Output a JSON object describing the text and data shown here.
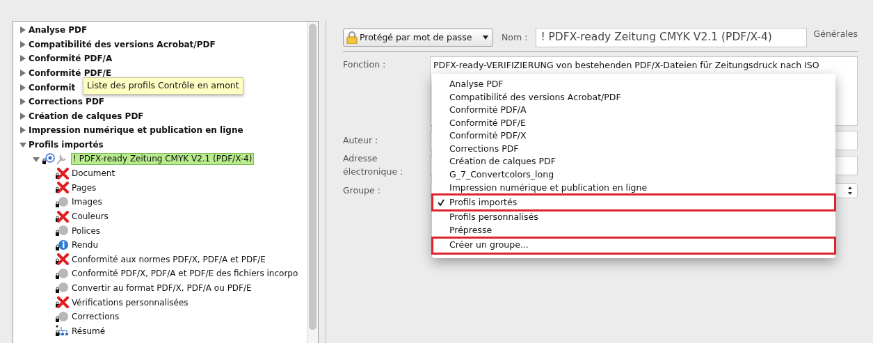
{
  "tree": [
    {
      "label": "Analyse PDF",
      "expanded": false
    },
    {
      "label": "Compatibilité des versions Acrobat/PDF",
      "expanded": false
    },
    {
      "label": "Conformité PDF/A",
      "expanded": false
    },
    {
      "label": "Conformité PDF/E",
      "expanded": false
    },
    {
      "label": "Conformit",
      "expanded": false
    },
    {
      "label": "Corrections PDF",
      "expanded": false
    },
    {
      "label": "Création de calques PDF",
      "expanded": false
    },
    {
      "label": "Impression numérique et publication en ligne",
      "expanded": false
    },
    {
      "label": "Profils importés",
      "expanded": true,
      "children": [
        {
          "label": "! PDFX-ready Zeitung CMYK V2.1 (PDF/X-4)",
          "kind": "profile",
          "expanded": true,
          "selected": true,
          "children": [
            {
              "label": "Document",
              "kind": "error"
            },
            {
              "label": "Pages",
              "kind": "error"
            },
            {
              "label": "Images",
              "kind": "inactive"
            },
            {
              "label": "Couleurs",
              "kind": "error"
            },
            {
              "label": "Polices",
              "kind": "inactive"
            },
            {
              "label": "Rendu",
              "kind": "info"
            },
            {
              "label": "Conformité aux normes PDF/X, PDF/A et PDF/E",
              "kind": "error"
            },
            {
              "label": "Conformité PDF/X, PDF/A et PDF/E des fichiers incorpo",
              "kind": "inactive"
            },
            {
              "label": "Convertir au format PDF/X, PDF/A ou PDF/E",
              "kind": "inactive"
            },
            {
              "label": "Vérifications personnalisées",
              "kind": "error"
            },
            {
              "label": "Corrections",
              "kind": "inactive"
            },
            {
              "label": "Résumé",
              "kind": "summary"
            }
          ]
        }
      ]
    }
  ],
  "tooltip": "Liste des profils Contrôle en amont",
  "protection": {
    "value": "Protégé par mot de passe"
  },
  "name": {
    "label": "Nom :",
    "value": "! PDFX-ready Zeitung CMYK V2.1 (PDF/X-4)"
  },
  "section": "Générales",
  "function": {
    "label": "Fonction :",
    "value": "PDFX-ready-VERIFIZIERUNG von bestehenden PDF/X-Dateien für Zeitungsdruck nach ISO"
  },
  "author": {
    "label": "Auteur :"
  },
  "email": {
    "label": "Adresse électronique :"
  },
  "group": {
    "label": "Groupe :"
  },
  "group_menu": [
    {
      "label": "Analyse PDF",
      "selected": false,
      "highlighted": false
    },
    {
      "label": "Compatibilité des versions Acrobat/PDF",
      "selected": false,
      "highlighted": false
    },
    {
      "label": "Conformité PDF/A",
      "selected": false,
      "highlighted": false
    },
    {
      "label": "Conformité PDF/E",
      "selected": false,
      "highlighted": false
    },
    {
      "label": "Conformité PDF/X",
      "selected": false,
      "highlighted": false
    },
    {
      "label": "Corrections PDF",
      "selected": false,
      "highlighted": false
    },
    {
      "label": "Création de calques PDF",
      "selected": false,
      "highlighted": false
    },
    {
      "label": "G_7_Convertcolors_long",
      "selected": false,
      "highlighted": false
    },
    {
      "label": "Impression numérique et publication en ligne",
      "selected": false,
      "highlighted": false
    },
    {
      "label": "Profils importés",
      "selected": true,
      "highlighted": true
    },
    {
      "label": "Profils personnalisés",
      "selected": false,
      "highlighted": false
    },
    {
      "label": "Prépresse",
      "selected": false,
      "highlighted": false
    },
    {
      "label": "Créer un groupe...",
      "selected": false,
      "highlighted": true
    }
  ]
}
